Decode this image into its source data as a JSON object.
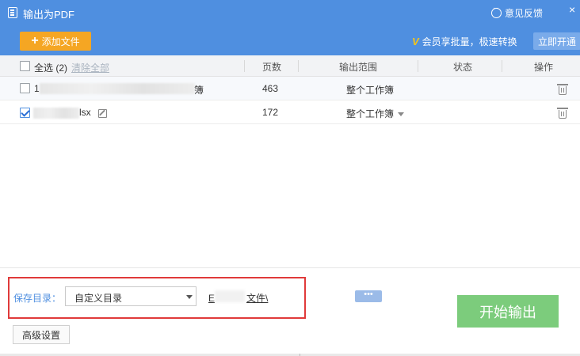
{
  "window": {
    "title": "输出为PDF",
    "feedback_label": "意见反馈",
    "close_glyph": "×"
  },
  "toolbar": {
    "add_file_label": "添加文件",
    "vip_text": "会员享批量，极速转换",
    "open_vip_label": "立即开通"
  },
  "table": {
    "select_all_label": "全选 (2)",
    "clear_all_label": "清除全部",
    "headers": {
      "pages": "页数",
      "range": "输出范围",
      "status": "状态",
      "actions": "操作"
    },
    "rows": [
      {
        "checked": false,
        "name_prefix": "1",
        "name_suffix": "簿",
        "pages": "463",
        "range": "整个工作簿",
        "status": ""
      },
      {
        "checked": true,
        "name_prefix": "",
        "name_suffix": "lsx",
        "pages": "172",
        "range": "整个工作簿",
        "status": ""
      }
    ]
  },
  "footer": {
    "save_label": "保存目录：",
    "save_dir_option": "自定义目录",
    "path_prefix": "E",
    "path_suffix": "文件\\",
    "more_label": "•••",
    "start_label": "开始输出",
    "advanced_label": "高级设置"
  },
  "colors": {
    "header_bg": "#4f8fe0",
    "add_button": "#f5a623",
    "start_button": "#7ccc7c",
    "highlight_frame": "#e03a3a"
  }
}
